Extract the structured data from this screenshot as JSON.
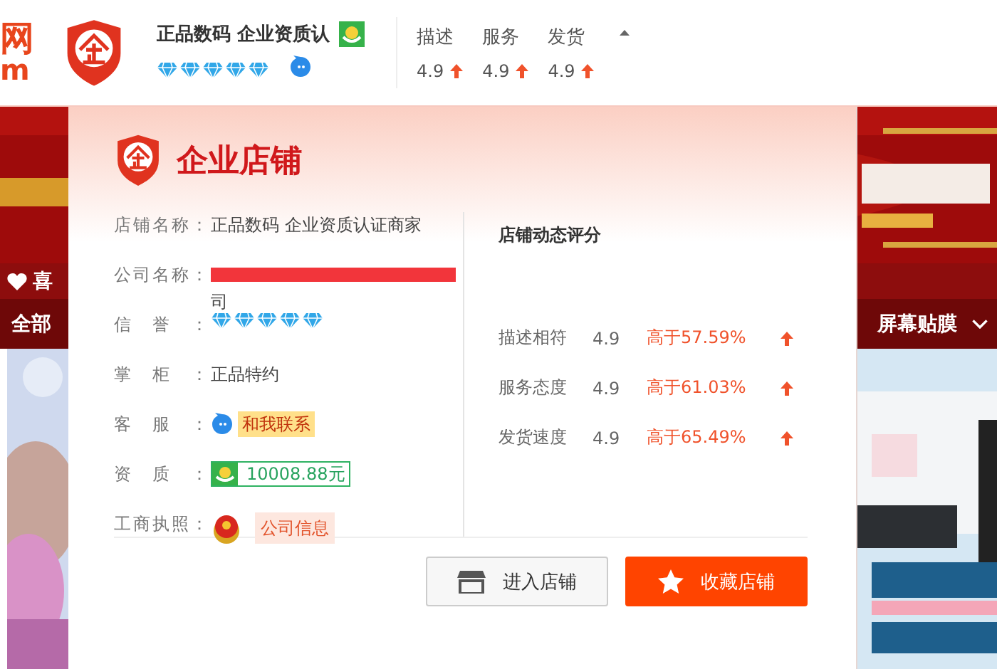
{
  "header": {
    "logo_text": [
      "网",
      "m"
    ],
    "shop_name": "正品数码 企业资质认",
    "credit": {
      "stars": 5
    },
    "ratings": [
      {
        "label": "描述",
        "value": "4.9"
      },
      {
        "label": "服务",
        "value": "4.9"
      },
      {
        "label": "发货",
        "value": "4.9"
      }
    ]
  },
  "nav": {
    "favorite": "喜",
    "all": "全部",
    "category": "屏幕贴膜"
  },
  "popup": {
    "title": "企业店铺",
    "rows": [
      {
        "kind": "text",
        "label": "店铺名称：",
        "value": "正品数码 企业资质认证商家"
      },
      {
        "kind": "redacted",
        "label": "公司名称：",
        "value": "司"
      },
      {
        "kind": "stars",
        "label": "信誉：",
        "stars": 5
      },
      {
        "kind": "text",
        "label": "掌柜：",
        "value": "正品特约"
      },
      {
        "kind": "contact",
        "label": "客服：",
        "value": "和我联系"
      },
      {
        "kind": "deposit",
        "label": "资质：",
        "value": "10008.88元"
      },
      {
        "kind": "license",
        "label": "工商执照：",
        "value": "公司信息"
      }
    ],
    "score_title": "店铺动态评分",
    "scores": [
      {
        "label": "描述相符",
        "value": "4.9",
        "compare": "高于57.59%"
      },
      {
        "label": "服务态度",
        "value": "4.9",
        "compare": "高于61.03%"
      },
      {
        "label": "发货速度",
        "value": "4.9",
        "compare": "高于65.49%"
      }
    ],
    "buttons": [
      {
        "kind": "enter",
        "label": "进入店铺"
      },
      {
        "kind": "favorite",
        "label": "收藏店铺"
      }
    ]
  }
}
